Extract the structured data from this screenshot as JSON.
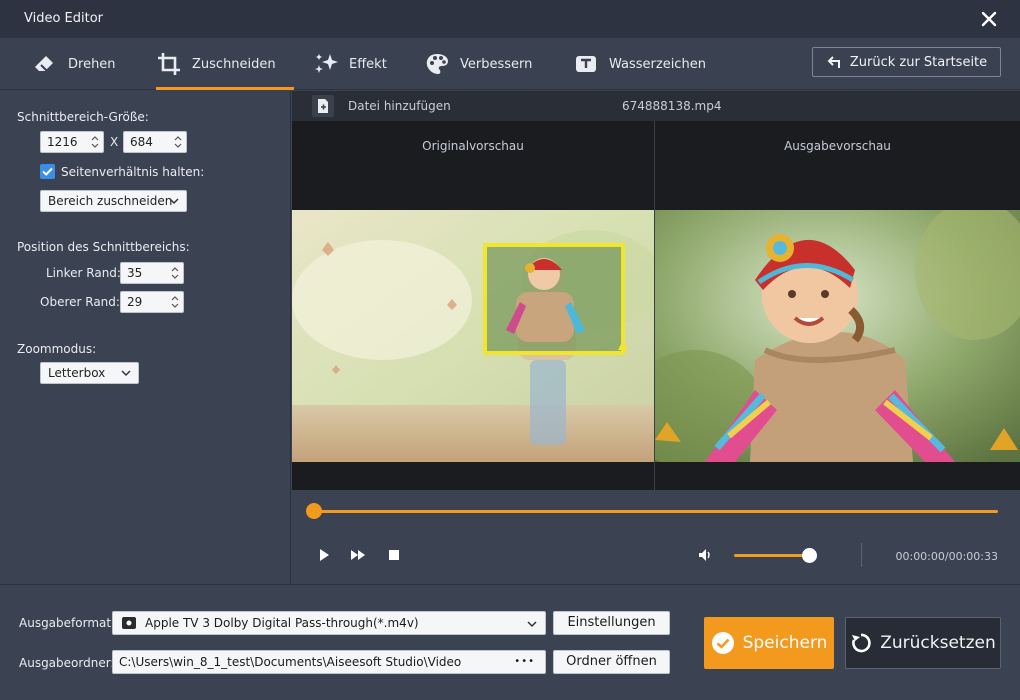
{
  "window": {
    "title": "Video Editor"
  },
  "tabs": [
    {
      "label": "Drehen",
      "icon": "eraser-icon"
    },
    {
      "label": "Zuschneiden",
      "icon": "crop-icon",
      "active": true
    },
    {
      "label": "Effekt",
      "icon": "sparkle-icon"
    },
    {
      "label": "Verbessern",
      "icon": "palette-icon"
    },
    {
      "label": "Wasserzeichen",
      "icon": "watermark-icon"
    }
  ],
  "back_button": {
    "label": "Zurück zur Startseite"
  },
  "crop": {
    "size_label": "Schnittbereich-Größe:",
    "width": "1216",
    "x_sep": "X",
    "height": "684",
    "keep_ratio_label": "Seitenverhältnis halten:",
    "keep_ratio_checked": true,
    "crop_mode": "Bereich zuschneiden",
    "position_label": "Position des Schnittbereichs:",
    "left_label": "Linker Rand:",
    "left_value": "35",
    "top_label": "Oberer Rand:",
    "top_value": "29",
    "zoom_label": "Zoommodus:",
    "zoom_value": "Letterbox"
  },
  "file": {
    "add_label": "Datei hinzufügen",
    "name": "674888138.mp4"
  },
  "preview": {
    "original_label": "Originalvorschau",
    "output_label": "Ausgabevorschau"
  },
  "player": {
    "progress": 0.0,
    "volume": 0.9,
    "time": "00:00:00/00:00:33"
  },
  "output": {
    "format_label": "Ausgabeformat:",
    "format_value": "Apple TV 3 Dolby Digital Pass-through(*.m4v)",
    "settings_button": "Einstellungen",
    "folder_label": "Ausgabeordner:",
    "folder_value": "C:\\Users\\win_8_1_test\\Documents\\Aiseesoft Studio\\Video",
    "browse_dots": "•••",
    "open_folder_button": "Ordner öffnen",
    "save_button": "Speichern",
    "reset_button": "Zurücksetzen"
  },
  "colors": {
    "accent": "#f39a1e",
    "crop_frame": "#f2e530",
    "checkbox": "#3a8ee6"
  }
}
